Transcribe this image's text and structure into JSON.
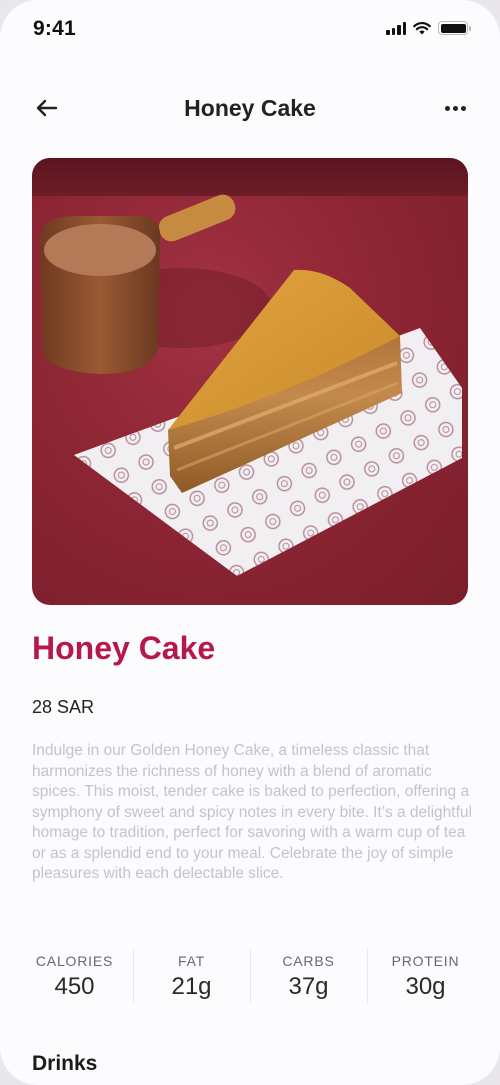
{
  "status_bar": {
    "time": "9:41",
    "icons": [
      "cellular-signal-icon",
      "wifi-icon",
      "battery-icon"
    ]
  },
  "nav": {
    "back_icon": "arrow-left-icon",
    "title": "Honey Cake",
    "more_icon": "more-horizontal-icon"
  },
  "product": {
    "image_alt": "Slice of honey cake on patterned paper with a small pitcher of sauce on a red velvet surface",
    "name": "Honey Cake",
    "price": "28 SAR",
    "description": "Indulge in our Golden Honey Cake, a timeless classic that harmonizes the richness of honey with a blend of aromatic spices. This moist, tender cake is baked to perfection, offering a symphony of sweet and spicy notes in every bite. It’s a delightful homage to tradition, perfect for savoring with a warm cup of tea or as a splendid end to your meal. Celebrate the joy of simple pleasures with each delectable slice."
  },
  "nutrition": [
    {
      "label": "CALORIES",
      "value": "450"
    },
    {
      "label": "FAT",
      "value": "21g"
    },
    {
      "label": "CARBS",
      "value": "37g"
    },
    {
      "label": "PROTEIN",
      "value": "30g"
    }
  ],
  "sections": {
    "drinks_title": "Drinks"
  },
  "colors": {
    "accent": "#b7184a",
    "background": "#fcfbfd",
    "description_text": "#c6c3c8"
  }
}
